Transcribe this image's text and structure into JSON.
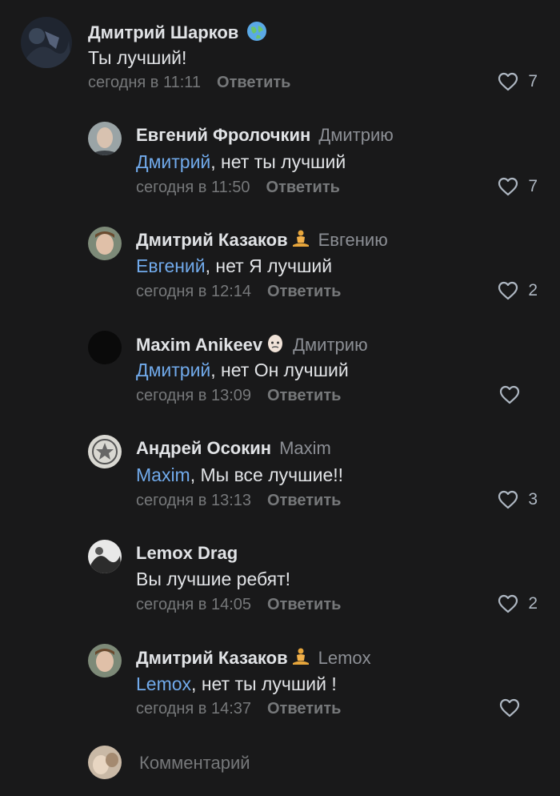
{
  "comments": [
    {
      "author": "Дмитрий Шарков",
      "to": "",
      "mention": "",
      "text": "Ты лучший!",
      "time": "сегодня в 11:11",
      "reply": "Ответить",
      "likes": "7",
      "emoji": "globe-icon"
    },
    {
      "author": "Евгений Фролочкин",
      "to": "Дмитрию",
      "mention": "Дмитрий",
      "text": ", нет ты лучший",
      "time": "сегодня в 11:50",
      "reply": "Ответить",
      "likes": "7"
    },
    {
      "author": "Дмитрий Казаков",
      "to": "Евгению",
      "mention": "Евгений",
      "text": ", нет Я лучший",
      "time": "сегодня в 12:14",
      "reply": "Ответить",
      "likes": "2",
      "emoji": "meditation-icon"
    },
    {
      "author": "Maxim Anikeev",
      "to": "Дмитрию",
      "mention": "Дмитрий",
      "text": ", нет Он лучший",
      "time": "сегодня в 13:09",
      "reply": "Ответить",
      "likes": "",
      "emoji": "bald-head-icon"
    },
    {
      "author": "Андрей Осокин",
      "to": "Maxim",
      "mention": "Maxim",
      "text": ", Мы все лучшие!!",
      "time": "сегодня в 13:13",
      "reply": "Ответить",
      "likes": "3"
    },
    {
      "author": "Lemox Drag",
      "to": "",
      "mention": "",
      "text": "Вы лучшие ребят!",
      "time": "сегодня в 14:05",
      "reply": "Ответить",
      "likes": "2"
    },
    {
      "author": "Дмитрий Казаков",
      "to": "Lemox",
      "mention": "Lemox",
      "text": ", нет ты лучший !",
      "time": "сегодня в 14:37",
      "reply": "Ответить",
      "likes": "",
      "emoji": "meditation-icon"
    }
  ],
  "input": {
    "placeholder": "Комментарий"
  },
  "colors": {
    "background": "#19191a",
    "text": "#e1e3e6",
    "secondary": "#76787a",
    "mention": "#71aaeb"
  }
}
